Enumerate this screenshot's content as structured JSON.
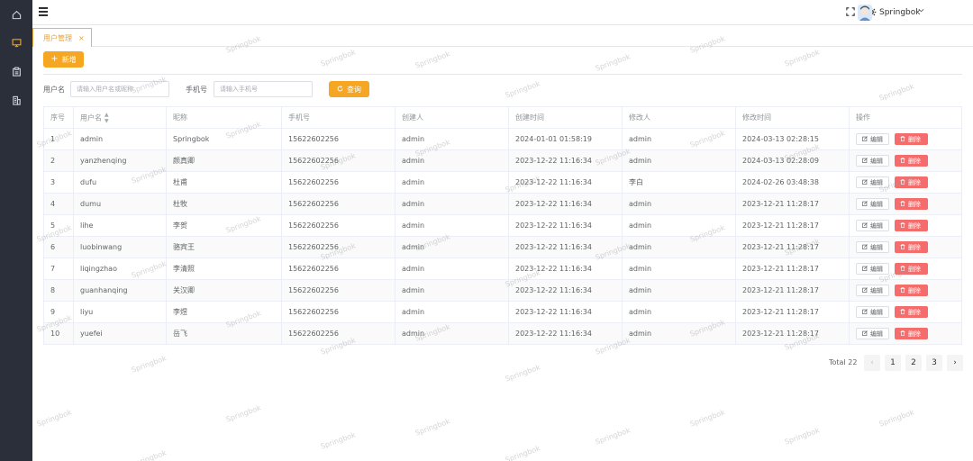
{
  "sidebar": {
    "icons": [
      "home-icon",
      "monitor-icon",
      "clipboard-icon",
      "building-icon"
    ]
  },
  "topbar": {
    "username": "Springbok",
    "icons": [
      "menu-icon",
      "fullscreen-icon",
      "gear-icon",
      "avatar",
      "chevron-down-icon"
    ]
  },
  "tabs": [
    {
      "label": "用户管理",
      "active": true
    }
  ],
  "toolbar": {
    "add_label": "新增"
  },
  "filter": {
    "username_label": "用户名",
    "username_placeholder": "请输入用户名或昵称",
    "phone_label": "手机号",
    "phone_placeholder": "请输入手机号",
    "search_label": "查询"
  },
  "table": {
    "headers": [
      "序号",
      "用户名",
      "昵称",
      "手机号",
      "创建人",
      "创建时间",
      "修改人",
      "修改时间",
      "操作"
    ],
    "edit_label": "编辑",
    "delete_label": "删除",
    "rows": [
      [
        "1",
        "admin",
        "Springbok",
        "15622602256",
        "admin",
        "2024-01-01 01:58:19",
        "admin",
        "2024-03-13 02:28:15"
      ],
      [
        "2",
        "yanzhenqing",
        "颜真卿",
        "15622602256",
        "admin",
        "2023-12-22 11:16:34",
        "admin",
        "2024-03-13 02:28:09"
      ],
      [
        "3",
        "dufu",
        "杜甫",
        "15622602256",
        "admin",
        "2023-12-22 11:16:34",
        "李白",
        "2024-02-26 03:48:38"
      ],
      [
        "4",
        "dumu",
        "杜牧",
        "15622602256",
        "admin",
        "2023-12-22 11:16:34",
        "admin",
        "2023-12-21 11:28:17"
      ],
      [
        "5",
        "lihe",
        "李贺",
        "15622602256",
        "admin",
        "2023-12-22 11:16:34",
        "admin",
        "2023-12-21 11:28:17"
      ],
      [
        "6",
        "luobinwang",
        "骆宾王",
        "15622602256",
        "admin",
        "2023-12-22 11:16:34",
        "admin",
        "2023-12-21 11:28:17"
      ],
      [
        "7",
        "liqingzhao",
        "李清照",
        "15622602256",
        "admin",
        "2023-12-22 11:16:34",
        "admin",
        "2023-12-21 11:28:17"
      ],
      [
        "8",
        "guanhanqing",
        "关汉卿",
        "15622602256",
        "admin",
        "2023-12-22 11:16:34",
        "admin",
        "2023-12-21 11:28:17"
      ],
      [
        "9",
        "liyu",
        "李煜",
        "15622602256",
        "admin",
        "2023-12-22 11:16:34",
        "admin",
        "2023-12-21 11:28:17"
      ],
      [
        "10",
        "yuefei",
        "岳飞",
        "15622602256",
        "admin",
        "2023-12-22 11:16:34",
        "admin",
        "2023-12-21 11:28:17"
      ]
    ]
  },
  "pagination": {
    "total_label": "Total 22",
    "pages": [
      "1",
      "2",
      "3"
    ],
    "prev": "‹",
    "next": "›"
  },
  "watermark": "Springbok",
  "colors": {
    "accent": "#f5a623",
    "danger": "#f56c6c",
    "sidebar": "#2b2f3a"
  }
}
